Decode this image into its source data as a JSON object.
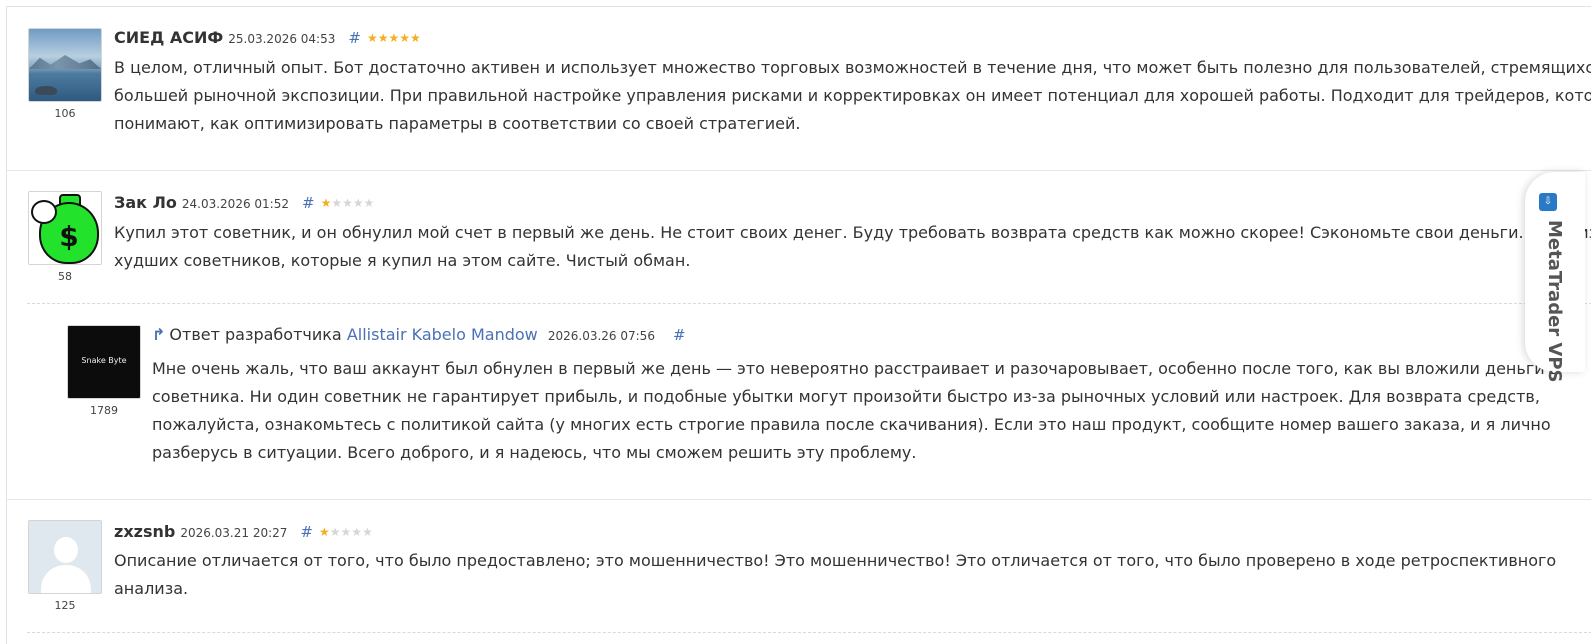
{
  "reviews": [
    {
      "author": "СИЕД АСИФ",
      "date": "25.03.2026 04:53",
      "rating": 5,
      "rank": "106",
      "lines": [
        "В целом, отличный опыт. Бот достаточно активен и использует множество торговых возможностей в течение дня, что может быть полезно для пользователей, стремящихся к",
        "большей рыночной экспозиции. При правильной настройке управления рисками и корректировках он имеет потенциал для хорошей работы. Подходит для трейдеров, которые",
        "понимают, как оптимизировать параметры в соответствии со своей стратегией."
      ]
    },
    {
      "author": "Зак Ло",
      "date": "24.03.2026 01:52",
      "rating": 1,
      "rank": "58",
      "lines": [
        "Купил этот советник, и он обнулил мой счет в первый же день. Не стоит своих денег. Буду требовать возврата средств как можно скорее! Сэкономьте свои деньги. Один из",
        "худших советников, которые я купил на этом сайте. Чистый обман."
      ],
      "reply": {
        "label": "Ответ разработчика",
        "developer": "Allistair Kabelo Mandow",
        "date": "2026.03.26 07:56",
        "rank": "1789",
        "logo_text": "Snake Byte",
        "lines": [
          "Мне очень жаль, что ваш аккаунт был обнулен в первый же день — это невероятно расстраивает и разочаровывает, особенно после того, как вы вложили деньги в",
          "советника. Ни один советник не гарантирует прибыль, и подобные убытки могут произойти быстро из-за рыночных условий или настроек. Для возврата средств,",
          "пожалуйста, ознакомьтесь с политикой сайта (у многих есть строгие правила после скачивания). Если это наш продукт, сообщите номер вашего заказа, и я лично",
          "разберусь в ситуации. Всего доброго, и я надеюсь, что мы сможем решить эту проблему."
        ]
      }
    },
    {
      "author": "zxzsnb",
      "date": "2026.03.21 20:27",
      "rating": 1,
      "rank": "125",
      "lines": [
        "Описание отличается от того, что было предоставлено; это мошенничество! Это мошенничество! Это отличается от того, что было проверено в ходе ретроспективного",
        "анализа."
      ]
    }
  ],
  "hash_symbol": "#",
  "side_tab": {
    "label": "MetaTrader VPS",
    "icon": "vps-icon"
  },
  "colors": {
    "link": "#4a70b5",
    "star_on": "#f2b01e",
    "star_off": "#d6d6d6"
  }
}
